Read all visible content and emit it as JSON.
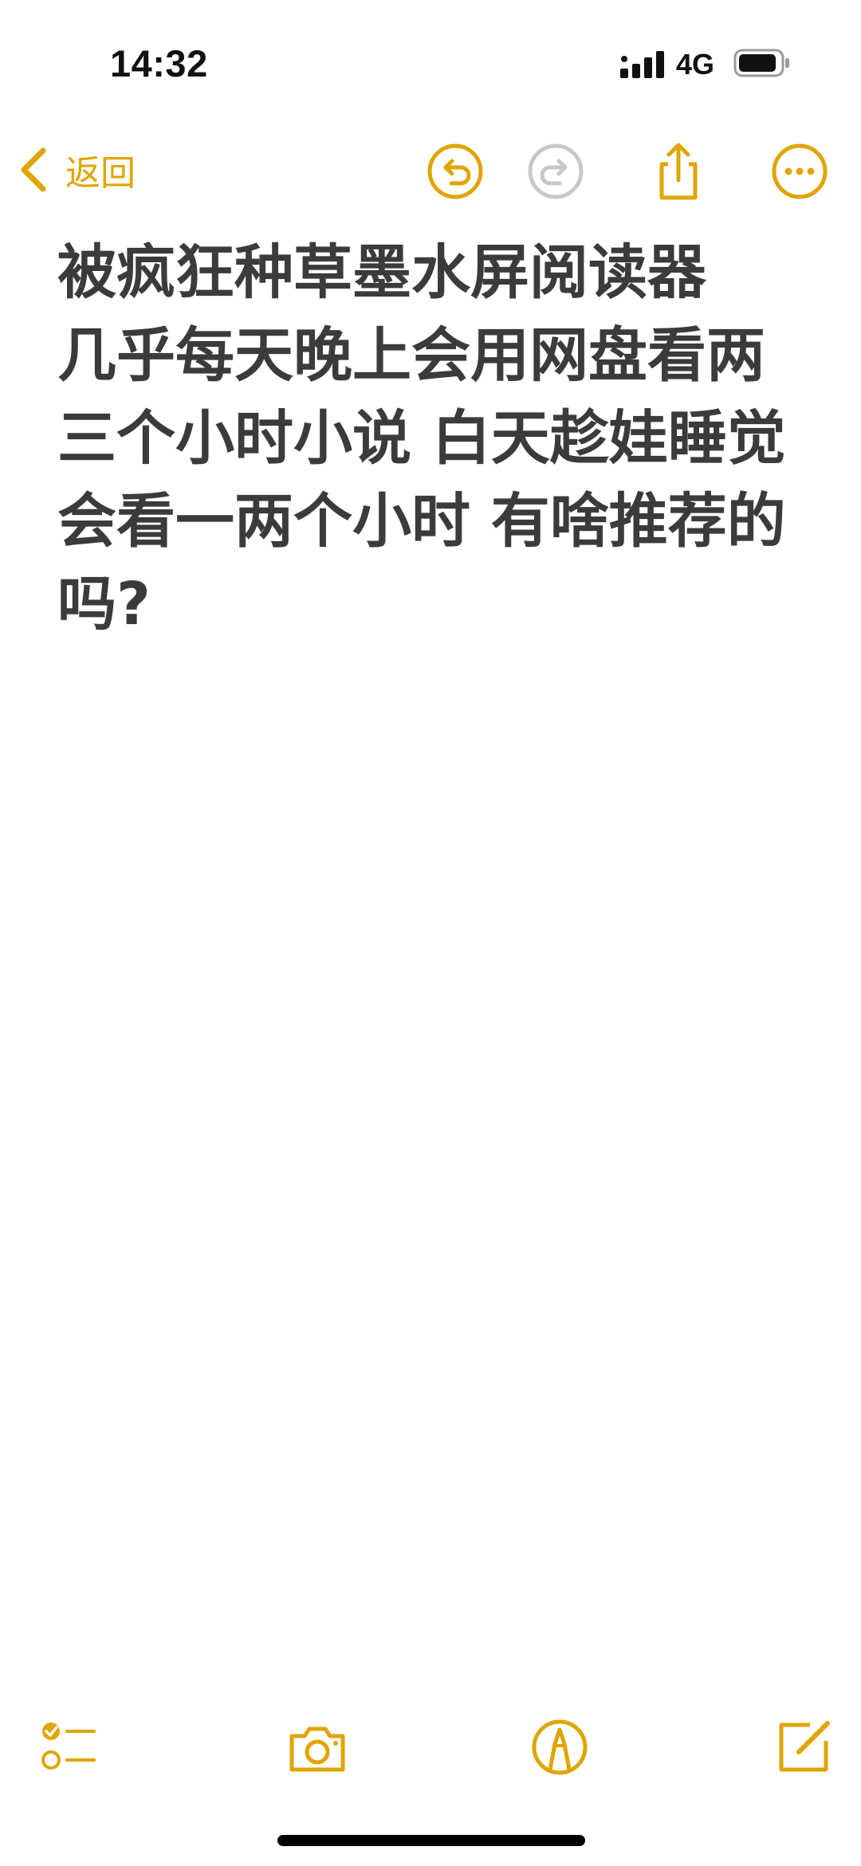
{
  "status_bar": {
    "time": "14:32",
    "network": "4G"
  },
  "nav": {
    "back_label": "返回",
    "icons": [
      "back-chevron-icon",
      "undo-icon",
      "redo-icon",
      "share-icon",
      "more-icon"
    ]
  },
  "note": {
    "title": "被疯狂种草墨水屏阅读器",
    "body": "几乎每天晚上会用网盘看两三个小时小说 白天趁娃睡觉会看一两个小时 有啥推荐的吗?"
  },
  "bottom_toolbar": {
    "icons": [
      "checklist-icon",
      "camera-icon",
      "markup-pen-icon",
      "compose-icon"
    ]
  },
  "colors": {
    "accent": "#E0A500",
    "disabled": "#C8C8C8",
    "text": "#3B3B3B",
    "background": "#FFFFFF"
  }
}
